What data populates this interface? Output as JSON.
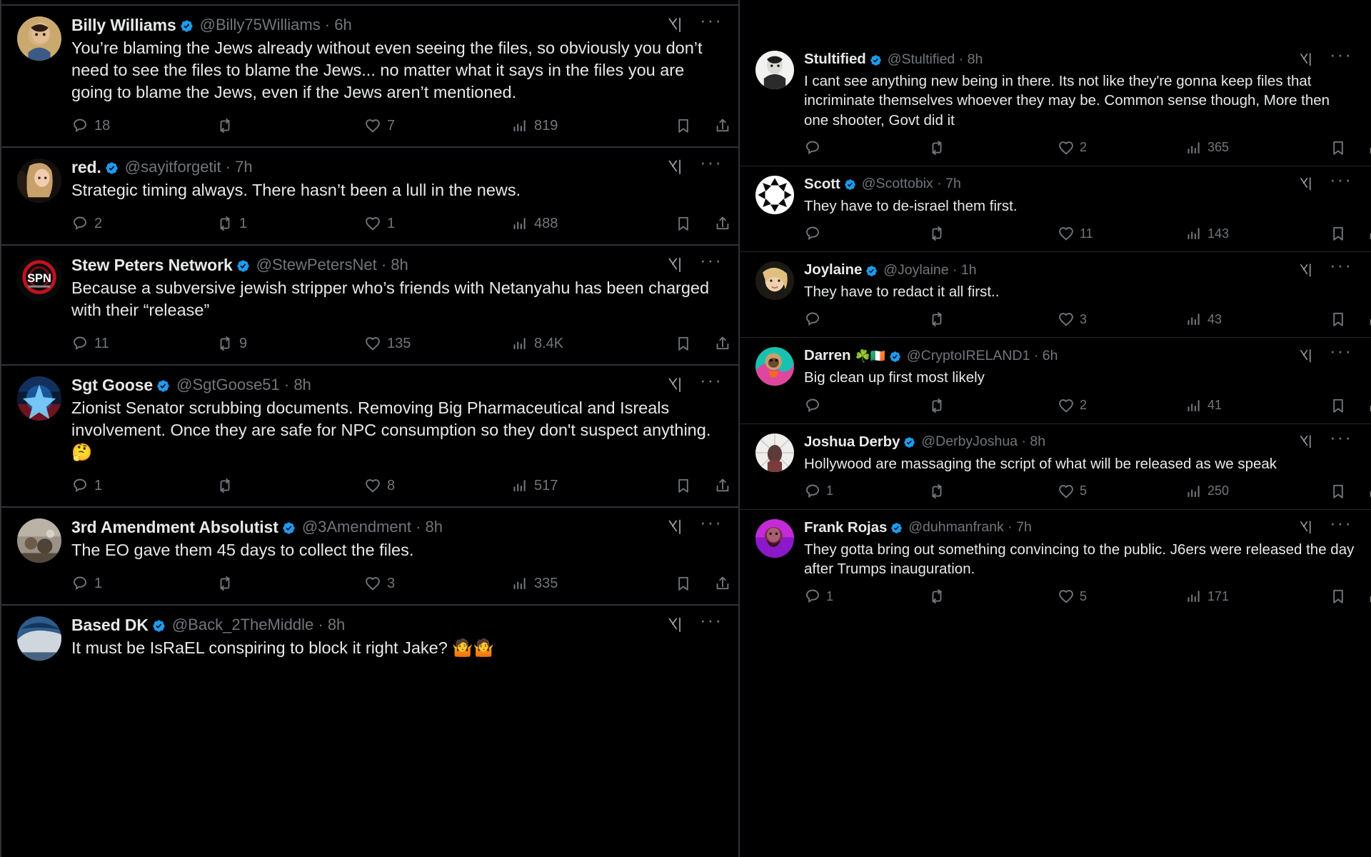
{
  "platform": {
    "accent_verified": "#1d9bf0",
    "text_primary": "#e7e9ea",
    "text_secondary": "#71767b",
    "background": "#000000",
    "divider": "#2f3336"
  },
  "icons": {
    "verified": "verified-badge-icon",
    "grok": "grok-x-icon",
    "more": "more-options-icon",
    "reply": "reply-icon",
    "repost": "repost-icon",
    "like": "like-heart-icon",
    "views": "views-analytics-icon",
    "bookmark": "bookmark-icon",
    "share": "share-icon"
  },
  "left_column": {
    "posts": [
      {
        "display_name": "Billy Williams",
        "verified": true,
        "handle": "@Billy75Williams",
        "separator": "·",
        "timestamp": "6h",
        "text": "You’re blaming the Jews already without even seeing the files, so obviously you don’t need to see the files to blame the Jews... no matter what it says in the files you are going to blame the Jews, even if the Jews aren’t mentioned.",
        "replies": "18",
        "reposts": "",
        "likes": "7",
        "views": "819"
      },
      {
        "display_name": "red.",
        "verified": true,
        "handle": "@sayitforgetit",
        "separator": "·",
        "timestamp": "7h",
        "text": "Strategic timing always. There hasn’t been a lull in the news.",
        "replies": "2",
        "reposts": "1",
        "likes": "1",
        "views": "488"
      },
      {
        "display_name": "Stew Peters Network",
        "verified": true,
        "handle": "@StewPetersNet",
        "separator": "·",
        "timestamp": "8h",
        "text": "Because a subversive jewish stripper who’s friends with Netanyahu has been charged with their “release”",
        "replies": "11",
        "reposts": "9",
        "likes": "135",
        "views": "8.4K"
      },
      {
        "display_name": "Sgt Goose",
        "verified": true,
        "handle": "@SgtGoose51",
        "separator": "·",
        "timestamp": "8h",
        "text": "Zionist Senator scrubbing documents. Removing Big Pharmaceutical and Isreals involvement. Once they are safe for NPC consumption so they don't suspect anything. 🤔",
        "replies": "1",
        "reposts": "",
        "likes": "8",
        "views": "517"
      },
      {
        "display_name": "3rd Amendment Absolutist",
        "verified": true,
        "handle": "@3Amendment",
        "separator": "·",
        "timestamp": "8h",
        "text": "The EO gave them 45 days to collect the files.",
        "replies": "1",
        "reposts": "",
        "likes": "3",
        "views": "335"
      },
      {
        "display_name": "Based DK",
        "verified": true,
        "handle": "@Back_2TheMiddle",
        "separator": "·",
        "timestamp": "8h",
        "text": "It must be IsRaEL conspiring to block it right Jake? 🤷🤷",
        "replies": "",
        "reposts": "",
        "likes": "",
        "views": ""
      }
    ]
  },
  "right_column": {
    "posts": [
      {
        "display_name": "Stultified",
        "verified": true,
        "handle": "@Stultified",
        "separator": "·",
        "timestamp": "8h",
        "text": "I cant see anything new being in there. Its not like they're gonna keep files that incriminate themselves whoever they may be. Common sense though, More then one shooter, Govt did it",
        "replies": "",
        "reposts": "",
        "likes": "2",
        "views": "365"
      },
      {
        "display_name": "Scott",
        "verified": true,
        "handle": "@Scottobix",
        "separator": "·",
        "timestamp": "7h",
        "text": "They have to de-israel them first.",
        "replies": "",
        "reposts": "",
        "likes": "11",
        "views": "143"
      },
      {
        "display_name": "Joylaine",
        "verified": true,
        "handle": "@Joylaine",
        "separator": "·",
        "timestamp": "1h",
        "text": "They have to redact it all first..",
        "replies": "",
        "reposts": "",
        "likes": "3",
        "views": "43"
      },
      {
        "display_name": "Darren",
        "name_emoji": "☘️🇮🇪",
        "verified": true,
        "handle": "@CryptoIRELAND1",
        "separator": "·",
        "timestamp": "6h",
        "text": "Big clean up first most likely",
        "replies": "",
        "reposts": "",
        "likes": "2",
        "views": "41"
      },
      {
        "display_name": "Joshua Derby",
        "verified": true,
        "handle": "@DerbyJoshua",
        "separator": "·",
        "timestamp": "8h",
        "text": "Hollywood are massaging the script of what will be released as we speak",
        "replies": "1",
        "reposts": "",
        "likes": "5",
        "views": "250"
      },
      {
        "display_name": "Frank Rojas",
        "verified": true,
        "handle": "@duhmanfrank",
        "separator": "·",
        "timestamp": "7h",
        "text": "They gotta bring out something convincing to the public. J6ers were released the day after Trumps inauguration.",
        "replies": "1",
        "reposts": "",
        "likes": "5",
        "views": "171"
      }
    ]
  }
}
